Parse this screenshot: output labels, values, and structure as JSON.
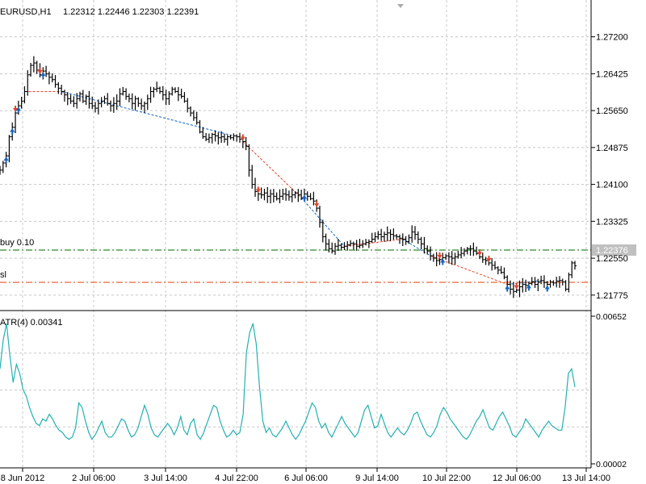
{
  "header": {
    "symbol_tf": "EURUSD,H1",
    "ohlc": "1.22312 1.22446 1.22303 1.22391"
  },
  "price_panel": {
    "yticks": [
      "1.27200",
      "1.26425",
      "1.25650",
      "1.24875",
      "1.24100",
      "1.23325",
      "1.22550",
      "1.21775"
    ],
    "current_price": "1.22376",
    "buy_line_label": "buy 0.10",
    "sl_line_label": "sl",
    "buy_line_color": "#2e8b2e",
    "sl_line_color": "#e8663a",
    "current_price_bg": "#c0c0c0"
  },
  "atr_panel": {
    "title": "ATR(4) 0.00341",
    "yticks": [
      "0.00652",
      "0.00002"
    ],
    "line_color": "#26b0b0"
  },
  "xaxis": {
    "labels": [
      "8 Jun 2012",
      "2 Jul 06:00",
      "3 Jul 14:00",
      "4 Jul 22:00",
      "6 Jul 06:00",
      "9 Jul 14:00",
      "10 Jul 22:00",
      "12 Jul 06:00",
      "13 Jul 14:00"
    ]
  },
  "colors": {
    "grid": "#c8c8c8",
    "bars": "#000000",
    "buy_arrow": "#1565c0",
    "sell_arrow": "#e0442a",
    "trade_line_buy": "#1565c0",
    "trade_line_sell": "#e0442a"
  },
  "chart_data": [
    {
      "type": "ohlc",
      "title": "EURUSD,H1",
      "ylim": [
        1.2145,
        1.276
      ],
      "series": [
        {
          "values": [
            1.244,
            1.2455,
            1.247,
            1.251,
            1.253,
            1.256,
            1.2575,
            1.2585,
            1.2605,
            1.264,
            1.266,
            1.2665,
            1.265,
            1.264,
            1.2648,
            1.2642,
            1.2635,
            1.263,
            1.262,
            1.2612,
            1.2605,
            1.2598,
            1.259,
            1.2585,
            1.258,
            1.259,
            1.26,
            1.2585,
            1.2595,
            1.258,
            1.2575,
            1.257,
            1.258,
            1.2585,
            1.259,
            1.258,
            1.2575,
            1.258,
            1.2585,
            1.26,
            1.2605,
            1.2595,
            1.259,
            1.258,
            1.259,
            1.258,
            1.2575,
            1.258,
            1.259,
            1.2605,
            1.261,
            1.2612,
            1.2605,
            1.2598,
            1.259,
            1.26,
            1.261,
            1.2605,
            1.2598,
            1.2595,
            1.2585,
            1.257,
            1.256,
            1.255,
            1.254,
            1.252,
            1.251,
            1.2505,
            1.2508,
            1.2515,
            1.2512,
            1.2508,
            1.251,
            1.2505,
            1.251,
            1.2508,
            1.2512,
            1.251,
            1.2505,
            1.25,
            1.249,
            1.244,
            1.241,
            1.2395,
            1.239,
            1.2388,
            1.2392,
            1.2385,
            1.239,
            1.2385,
            1.238,
            1.2385,
            1.239,
            1.2388,
            1.2384,
            1.2388,
            1.2392,
            1.2388,
            1.2382,
            1.239,
            1.2385,
            1.238,
            1.2375,
            1.236,
            1.233,
            1.23,
            1.2285,
            1.2275,
            1.227,
            1.228,
            1.2282,
            1.2278,
            1.228,
            1.2283,
            1.2286,
            1.2285,
            1.228,
            1.2282,
            1.2285,
            1.2288,
            1.229,
            1.2295,
            1.23,
            1.2305,
            1.23,
            1.2305,
            1.2308,
            1.2305,
            1.2302,
            1.23,
            1.2297,
            1.2295,
            1.229,
            1.2298,
            1.231,
            1.2305,
            1.2295,
            1.2285,
            1.2275,
            1.227,
            1.226,
            1.2255,
            1.225,
            1.2252,
            1.2256,
            1.226,
            1.2258,
            1.2255,
            1.2258,
            1.2262,
            1.2265,
            1.227,
            1.2275,
            1.2275,
            1.227,
            1.2265,
            1.2258,
            1.2252,
            1.225,
            1.2245,
            1.224,
            1.2235,
            1.223,
            1.2225,
            1.2215,
            1.22,
            1.219,
            1.2185,
            1.2188,
            1.2195,
            1.22,
            1.2198,
            1.2202,
            1.2205,
            1.22,
            1.2205,
            1.2208,
            1.2204,
            1.22,
            1.2205,
            1.2203,
            1.2207,
            1.2208,
            1.2205,
            1.219,
            1.222,
            1.2245,
            1.2239
          ]
        }
      ]
    },
    {
      "type": "line",
      "title": "ATR(4) 0.00341",
      "ylim": [
        2e-05,
        0.00652
      ],
      "series": [
        {
          "values": [
            0.0042,
            0.0055,
            0.0062,
            0.0048,
            0.0036,
            0.0044,
            0.004,
            0.0033,
            0.003,
            0.0025,
            0.0021,
            0.0018,
            0.0017,
            0.002,
            0.0019,
            0.0022,
            0.002,
            0.0017,
            0.0015,
            0.0014,
            0.0012,
            0.0011,
            0.0012,
            0.0016,
            0.0027,
            0.0025,
            0.0019,
            0.0014,
            0.0011,
            0.0013,
            0.0016,
            0.0019,
            0.0014,
            0.0012,
            0.0012,
            0.0014,
            0.0017,
            0.002,
            0.0019,
            0.0015,
            0.0012,
            0.0013,
            0.0016,
            0.0021,
            0.0026,
            0.0022,
            0.0016,
            0.0013,
            0.0012,
            0.0014,
            0.0016,
            0.0018,
            0.0016,
            0.0013,
            0.0016,
            0.0021,
            0.0015,
            0.0013,
            0.0018,
            0.002,
            0.0013,
            0.0011,
            0.0014,
            0.0018,
            0.0022,
            0.0026,
            0.0025,
            0.0019,
            0.0015,
            0.0012,
            0.0013,
            0.0015,
            0.0013,
            0.0014,
            0.0022,
            0.0049,
            0.0058,
            0.0062,
            0.0053,
            0.0034,
            0.0019,
            0.0014,
            0.0016,
            0.0013,
            0.0012,
            0.0014,
            0.0016,
            0.0019,
            0.0016,
            0.0013,
            0.0011,
            0.0013,
            0.0016,
            0.0019,
            0.0023,
            0.0027,
            0.0025,
            0.0019,
            0.0016,
            0.0018,
            0.0014,
            0.0012,
            0.0015,
            0.0018,
            0.0021,
            0.0018,
            0.0016,
            0.0014,
            0.0012,
            0.0014,
            0.0019,
            0.0024,
            0.0026,
            0.0021,
            0.0016,
            0.0017,
            0.0022,
            0.0018,
            0.0014,
            0.0012,
            0.0014,
            0.0016,
            0.0014,
            0.0013,
            0.0015,
            0.0018,
            0.0022,
            0.0023,
            0.0019,
            0.0016,
            0.0013,
            0.0012,
            0.0014,
            0.0017,
            0.0022,
            0.0025,
            0.0023,
            0.002,
            0.0018,
            0.0016,
            0.0014,
            0.0012,
            0.0011,
            0.0013,
            0.0016,
            0.0019,
            0.0021,
            0.0024,
            0.002,
            0.0016,
            0.0015,
            0.0018,
            0.0021,
            0.0023,
            0.002,
            0.0017,
            0.0013,
            0.0012,
            0.0014,
            0.0016,
            0.002,
            0.0018,
            0.0016,
            0.0014,
            0.0012,
            0.0015,
            0.0017,
            0.0019,
            0.0017,
            0.0016,
            0.0015,
            0.0015,
            0.0025,
            0.004,
            0.0042,
            0.0034
          ]
        }
      ]
    }
  ]
}
